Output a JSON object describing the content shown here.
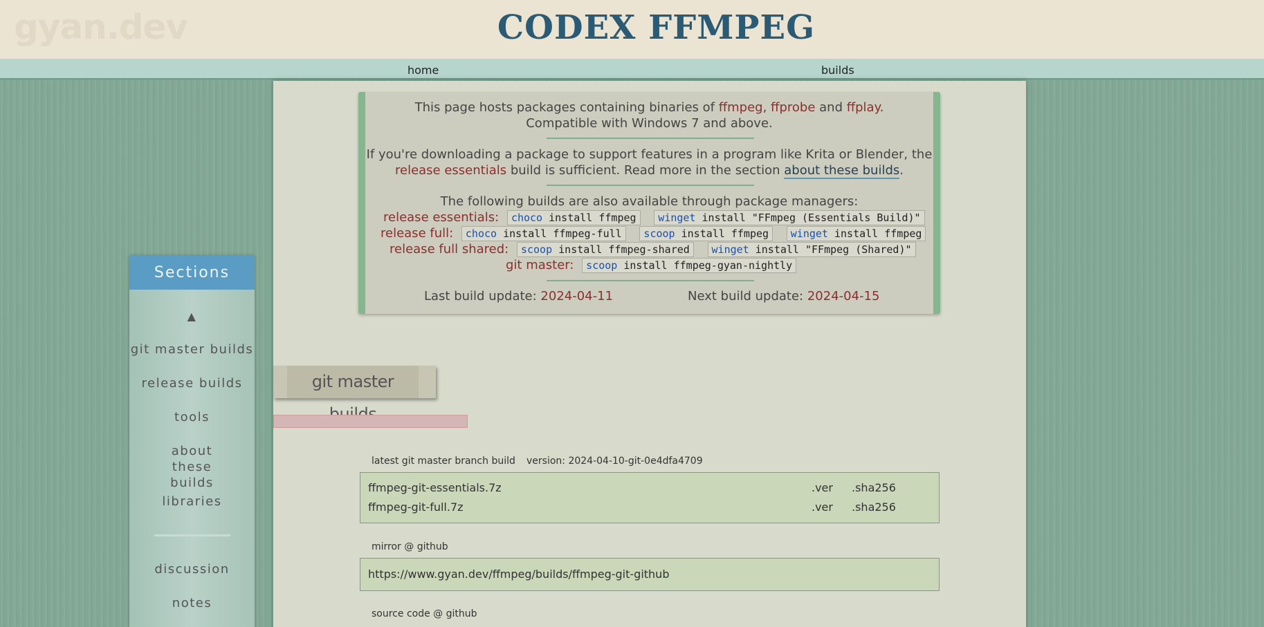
{
  "header": {
    "logo": "gyan.dev",
    "title": "CODEX FFMPEG"
  },
  "nav": {
    "home": "home",
    "builds": "builds"
  },
  "info": {
    "line1_pre": "This page hosts packages containing binaries of ",
    "ffmpeg": "ffmpeg",
    "comma": ", ",
    "ffprobe": "ffprobe",
    "and": " and ",
    "ffplay": "ffplay",
    "period": ".",
    "line2": "Compatible with Windows 7 and above.",
    "line3": "If you're downloading a package to support features in a program like Krita or Blender, the",
    "line4_hl": "release essentials",
    "line4_mid": " build is sufficient. Read more in the section ",
    "line4_link": "about these builds",
    "line4_end": ".",
    "pm_intro": "The following builds are also available through package managers:",
    "pm_rows": [
      {
        "label": "release essentials:",
        "cmds": [
          {
            "tool": "choco",
            "args": " install ffmpeg"
          },
          {
            "tool": "winget",
            "args": " install \"FFmpeg (Essentials Build)\""
          }
        ]
      },
      {
        "label": "release full:",
        "cmds": [
          {
            "tool": "choco",
            "args": " install ffmpeg-full"
          },
          {
            "tool": "scoop",
            "args": " install ffmpeg"
          },
          {
            "tool": "winget",
            "args": " install ffmpeg"
          }
        ]
      },
      {
        "label": "release full shared:",
        "cmds": [
          {
            "tool": "scoop",
            "args": " install ffmpeg-shared"
          },
          {
            "tool": "winget",
            "args": " install \"FFmpeg (Shared)\""
          }
        ]
      },
      {
        "label": "git master:",
        "cmds": [
          {
            "tool": "scoop",
            "args": " install ffmpeg-gyan-nightly"
          }
        ]
      }
    ],
    "last_label": "Last build update: ",
    "last_date": "2024-04-11",
    "next_label": "Next build update: ",
    "next_date": "2024-04-15"
  },
  "sidebar": {
    "title": "Sections",
    "up_arrow": "▲",
    "items": [
      "git master builds",
      "release builds",
      "tools",
      "about these builds",
      "libraries",
      "discussion",
      "notes"
    ]
  },
  "section": {
    "title": "git master builds",
    "latest_caption": "latest git master branch build",
    "version_caption": "version: 2024-04-10-git-0e4dfa4709",
    "files": [
      {
        "name": "ffmpeg-git-essentials.7z",
        "ver": ".ver",
        "sha": ".sha256"
      },
      {
        "name": "ffmpeg-git-full.7z",
        "ver": ".ver",
        "sha": ".sha256"
      }
    ],
    "mirror_caption": "mirror @ github",
    "mirror_url": "https://www.gyan.dev/ffmpeg/builds/ffmpeg-git-github",
    "source_caption": "source code @ github"
  }
}
